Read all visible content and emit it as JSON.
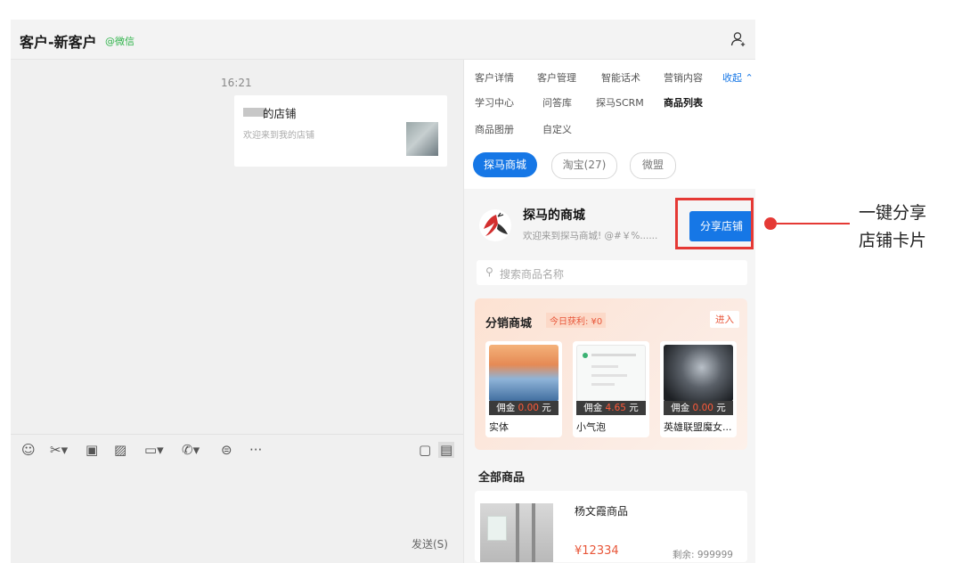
{
  "window": {
    "title": "客户-新客户",
    "wechat_tag": "@微信"
  },
  "chat": {
    "time": "16:21",
    "card": {
      "title": "的店铺",
      "desc": "欢迎来到我的店铺"
    },
    "send_label": "发送(S)"
  },
  "panel": {
    "nav": [
      {
        "label": "客户详情"
      },
      {
        "label": "客户管理"
      },
      {
        "label": "智能话术"
      },
      {
        "label": "营销内容"
      },
      {
        "label": "收起 ⌃"
      },
      {
        "label": "学习中心"
      },
      {
        "label": "问答库"
      },
      {
        "label": "探马SCRM"
      },
      {
        "label": "商品列表"
      },
      {
        "label": "商品图册"
      },
      {
        "label": "自定义"
      }
    ],
    "tabs": [
      {
        "label": "探马商城"
      },
      {
        "label": "淘宝(27)"
      },
      {
        "label": "微盟"
      }
    ],
    "shop": {
      "name": "探马的商城",
      "desc": "欢迎来到探马商城! @#￥%......",
      "share_button": "分享店铺"
    },
    "search_placeholder": "搜索商品名称",
    "distribution": {
      "title": "分销商城",
      "earnings": "今日获利: ¥0",
      "enter": "进入",
      "products": [
        {
          "commission_label": "佣金",
          "commission": "0.00",
          "unit": "元",
          "name": "实体"
        },
        {
          "commission_label": "佣金",
          "commission": "4.65",
          "unit": "元",
          "name": "小气泡"
        },
        {
          "commission_label": "佣金",
          "commission": "0.00",
          "unit": "元",
          "name": "英雄联盟魔女..."
        }
      ]
    },
    "all_goods": {
      "title": "全部商品",
      "item": {
        "name": "杨文霞商品",
        "price": "¥12334",
        "stock": "剩余: 999999"
      }
    }
  },
  "annotation": {
    "line1": "一键分享",
    "line2": "店铺卡片"
  },
  "colors": {
    "accent": "#1677e6",
    "highlight": "#e53935",
    "wechat_green": "#2fb34a"
  }
}
